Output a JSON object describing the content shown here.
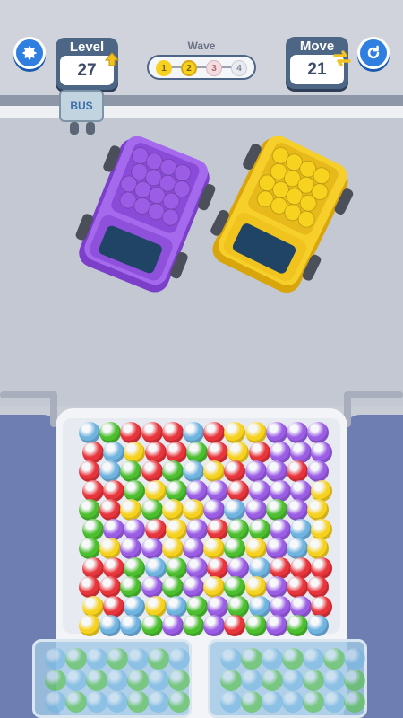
{
  "hud": {
    "level_label": "Level",
    "level_value": "27",
    "move_label": "Move",
    "move_value": "21",
    "wave_label": "Wave",
    "wave_steps": [
      "1",
      "2",
      "3",
      "4"
    ],
    "wave_current": 2,
    "settings_icon": "gear-icon",
    "restart_icon": "restart-icon"
  },
  "bus_stop": {
    "label": "BUS"
  },
  "trucks": [
    {
      "name": "purple-truck",
      "color": "#9b5de5",
      "cargo_color": "#9b5de5"
    },
    {
      "name": "yellow-truck",
      "color": "#f5c518",
      "cargo_color": "#f7d21e"
    }
  ],
  "colors": {
    "red": "#e8343b",
    "green": "#4cbf2f",
    "yellow": "#f6d21f",
    "purple": "#9b5de5",
    "blue": "#6fb3e0",
    "accent": "#2e7fe0",
    "card": "#4d6686"
  },
  "ball_grid": [
    "BGRRRBRYYPPP",
    "RBYRRGRYRPPP",
    "RBGRGBYRPPRP",
    "RRGYGPPRPPPY",
    "GRYGYYPBPGPY",
    "GPPRYPRGGPBY",
    "GYPPYPYGYPBY",
    "RRGBGPRPBRRR",
    "RRGPGPYGYPRR",
    "YRBYBGPGBPPR",
    "YBBGPGPRGPGB"
  ]
}
